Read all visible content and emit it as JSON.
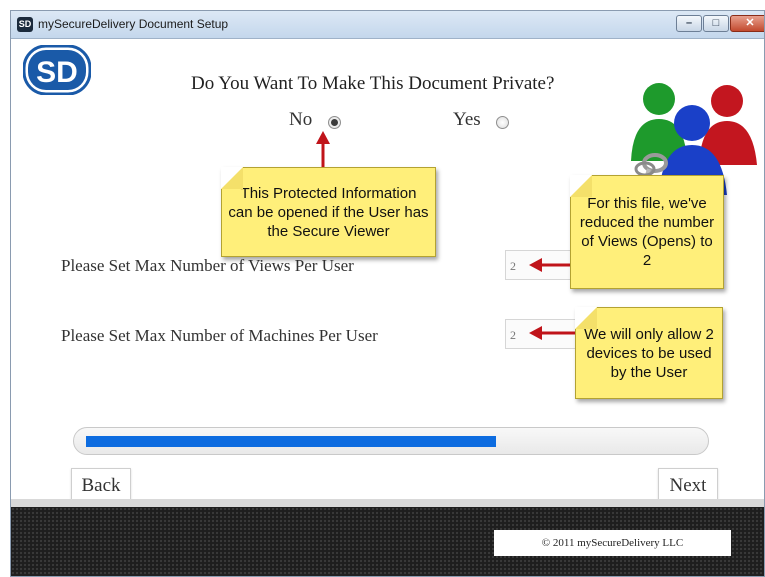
{
  "window": {
    "icon_text": "SD",
    "title": "mySecureDelivery Document Setup",
    "controls": {
      "minimize": "–",
      "maximize": "□",
      "close": "✕"
    }
  },
  "logo": {
    "text": "SD",
    "color": "#1a5aa8"
  },
  "privacy": {
    "question": "Do You Want To Make This Document Private?",
    "options": [
      {
        "label": "No",
        "selected": true
      },
      {
        "label": "Yes",
        "selected": false
      }
    ]
  },
  "fields": {
    "max_views": {
      "label": "Please Set Max Number of Views Per User",
      "value": "2"
    },
    "max_machines": {
      "label": "Please Set Max Number of Machines Per User",
      "value": "2"
    }
  },
  "callouts": {
    "secure_viewer": "This Protected Information can be opened if the User has the Secure Viewer",
    "views": "For this file, we've reduced the number of Views (Opens) to 2",
    "devices": "We will only allow 2 devices to be used by the User"
  },
  "progress": {
    "fraction": 0.67,
    "color": "#0d6ce0"
  },
  "buttons": {
    "back": "Back",
    "next": "Next"
  },
  "footer": {
    "copyright": "© 2011 mySecureDelivery LLC"
  },
  "colors": {
    "arrow": "#c0141a",
    "note": "#ffef7a"
  }
}
